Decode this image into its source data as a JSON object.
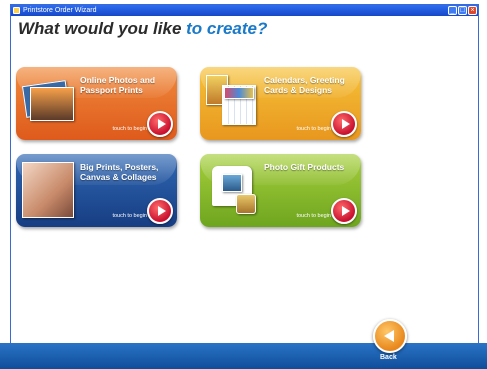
{
  "window": {
    "title": "Printstore Order Wizard"
  },
  "heading": {
    "prefix": "What would you like",
    "accent": "to create?"
  },
  "tiles": [
    {
      "label": "Online Photos and Passport Prints",
      "hint": "touch to begin",
      "color": "#e86f2a"
    },
    {
      "label": "Calendars, Greeting Cards & Designs",
      "hint": "touch to begin",
      "color": "#f0ab2a"
    },
    {
      "label": "Big Prints, Posters, Canvas & Collages",
      "hint": "touch to begin",
      "color": "#234f9a"
    },
    {
      "label": "Photo Gift Products",
      "hint": "touch to begin",
      "color": "#8bbd2e"
    }
  ],
  "footer": {
    "back_label": "Back"
  },
  "icons": {
    "tile_action": "play-icon",
    "back": "back-arrow-icon"
  }
}
